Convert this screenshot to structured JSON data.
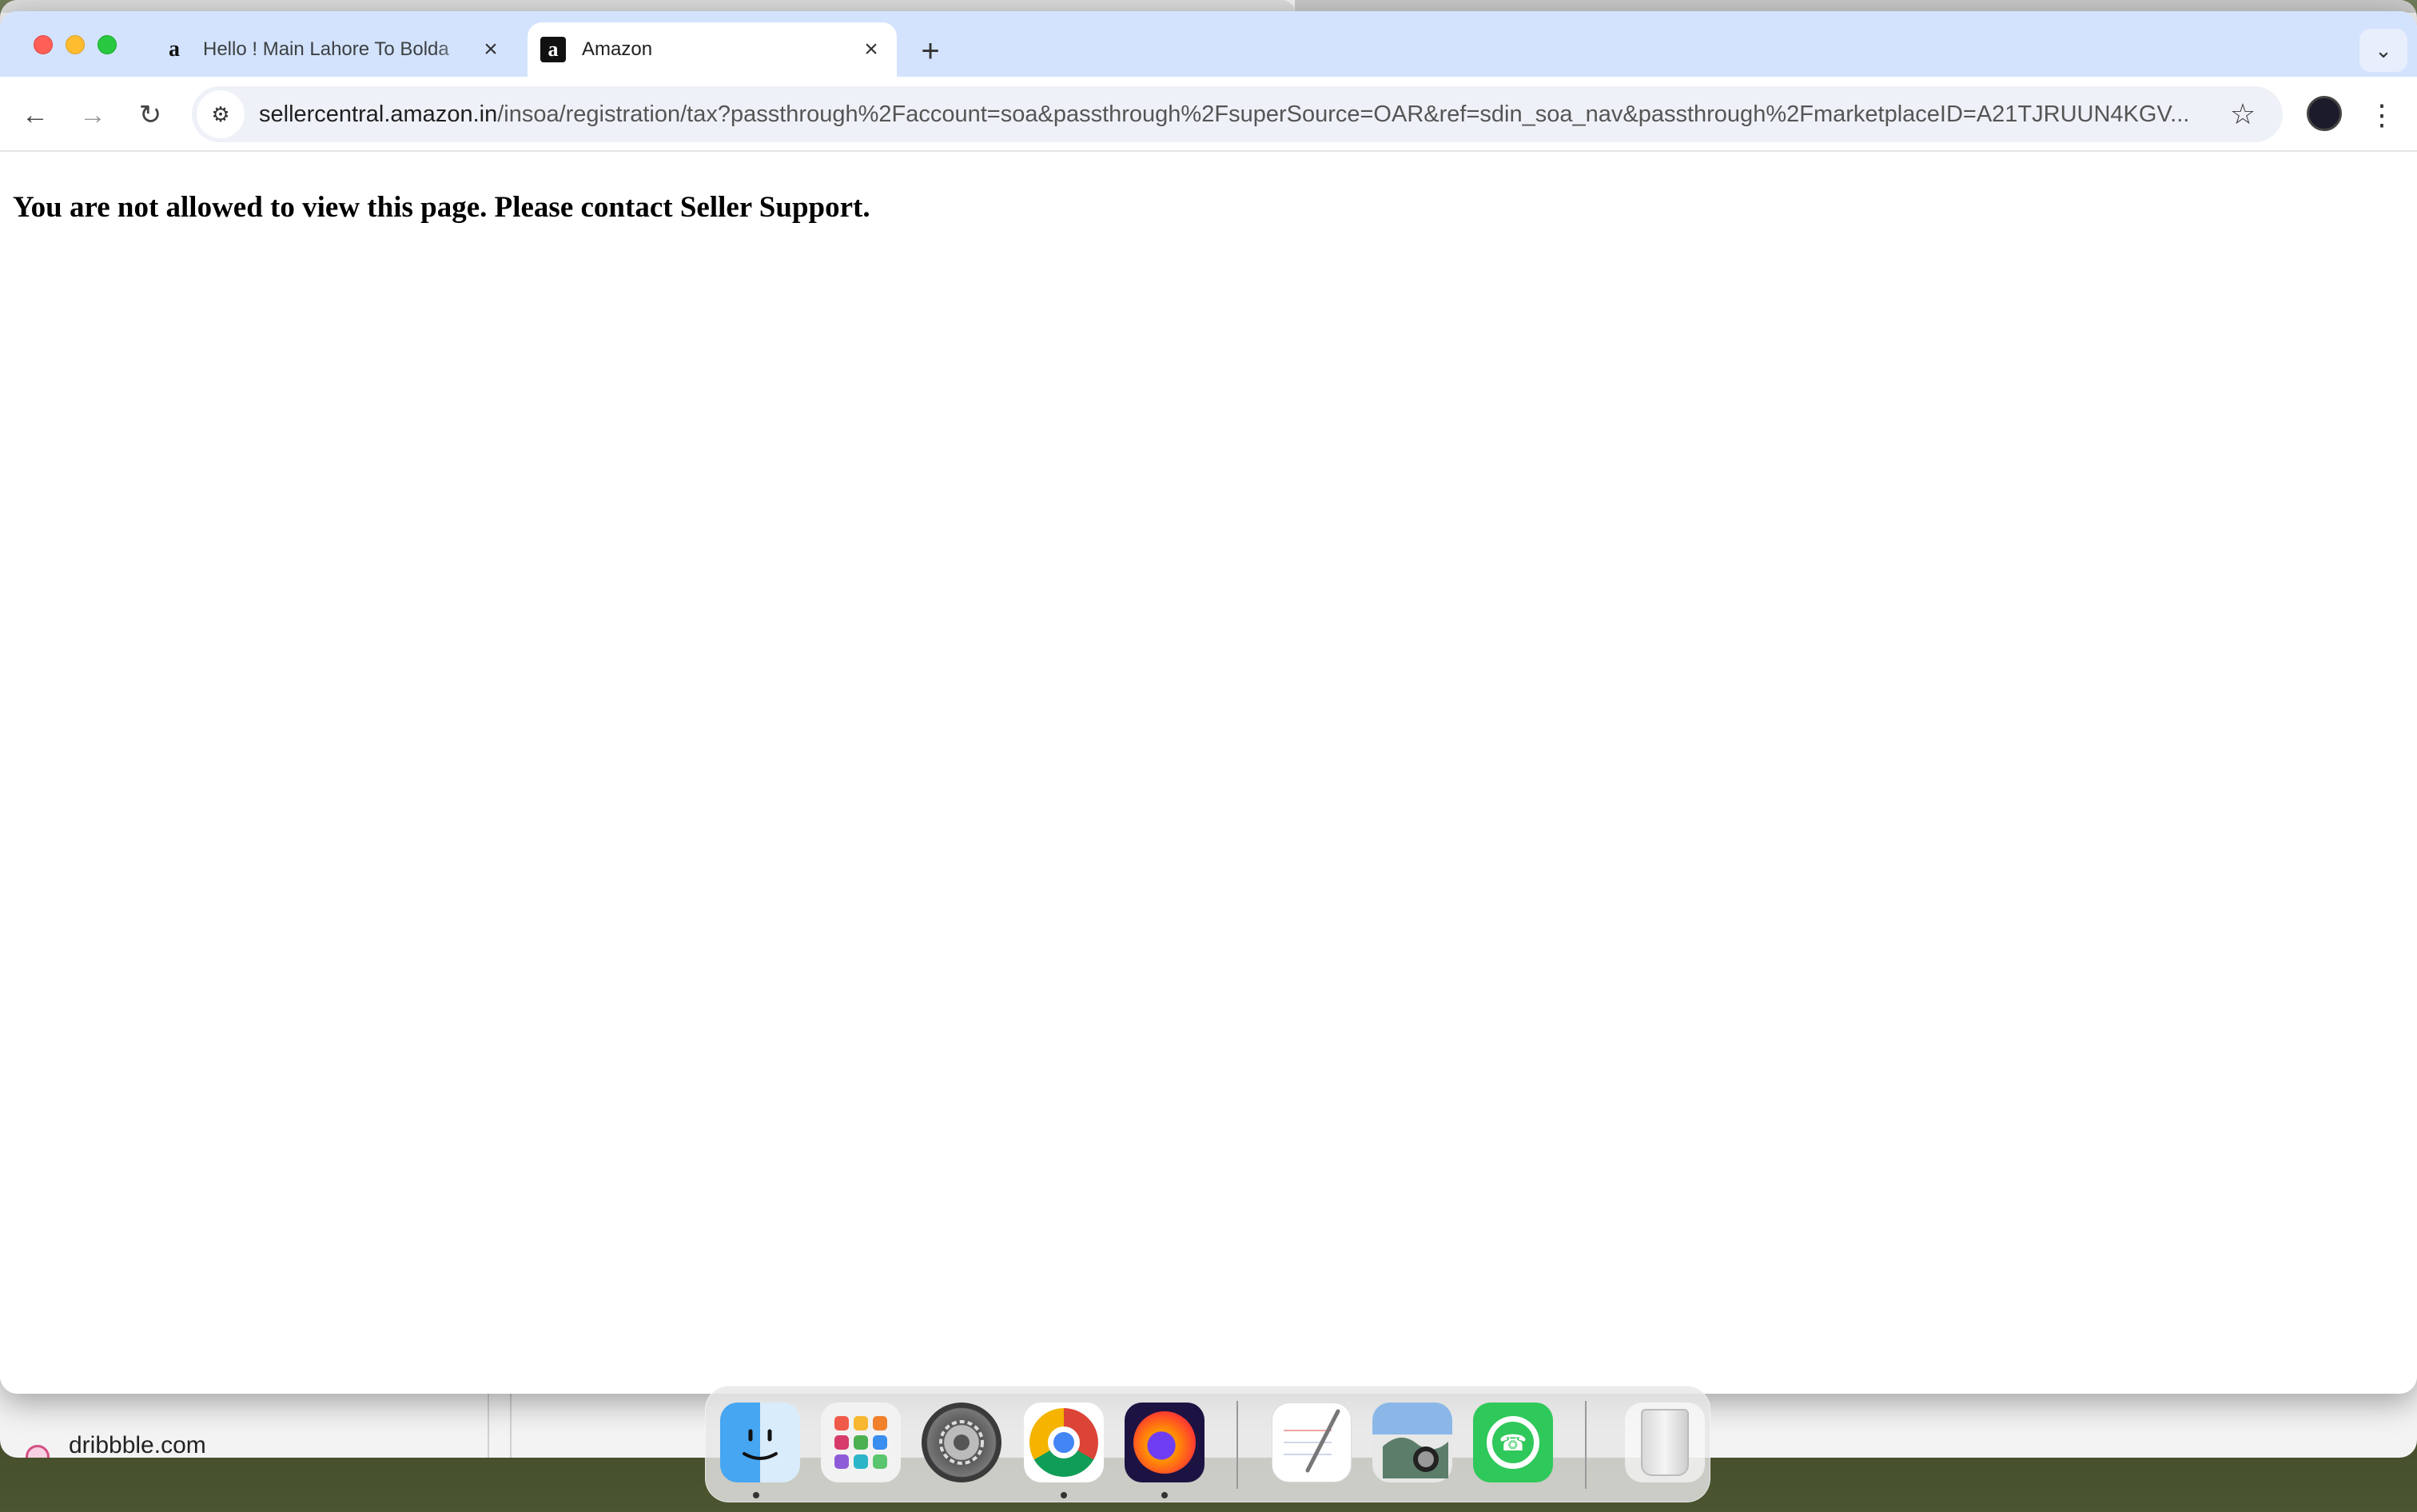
{
  "background_window": {
    "sidebar_site": "dribbble.com"
  },
  "browser": {
    "tabs": [
      {
        "favicon": "a",
        "title": "Hello ! Main Lahore To Bolda",
        "active": false
      },
      {
        "favicon": "a",
        "title": "Amazon",
        "active": true
      }
    ],
    "new_tab_icon": "+",
    "tab_search_icon": "⌄",
    "toolbar": {
      "back_icon": "←",
      "forward_icon": "→",
      "reload_icon": "↻",
      "site_info_icon": "⚙",
      "url_host": "sellercentral.amazon.in",
      "url_path": "/insoa/registration/tax?passthrough%2Faccount=soa&passthrough%2FsuperSource=OAR&ref=sdin_soa_nav&passthrough%2FmarketplaceID=A21TJRUUN4KGV...",
      "bookmark_icon": "☆",
      "menu_icon": "⋮"
    },
    "page": {
      "message": "You are not allowed to view this page. Please contact Seller Support."
    }
  },
  "dock": {
    "apps": [
      {
        "name": "Finder",
        "running": true
      },
      {
        "name": "Launchpad",
        "running": false
      },
      {
        "name": "System Settings",
        "running": false
      },
      {
        "name": "Google Chrome",
        "running": true
      },
      {
        "name": "Firefox",
        "running": true
      },
      {
        "name": "TextEdit",
        "running": false
      },
      {
        "name": "Preview",
        "running": false
      },
      {
        "name": "WhatsApp",
        "running": false
      },
      {
        "name": "Trash",
        "running": false
      }
    ]
  },
  "colors": {
    "tabstrip": "#d3e3fd",
    "omnibox": "#eef1f7",
    "traffic_close": "#ff5f57",
    "traffic_min": "#febc2e",
    "traffic_max": "#28c840"
  }
}
